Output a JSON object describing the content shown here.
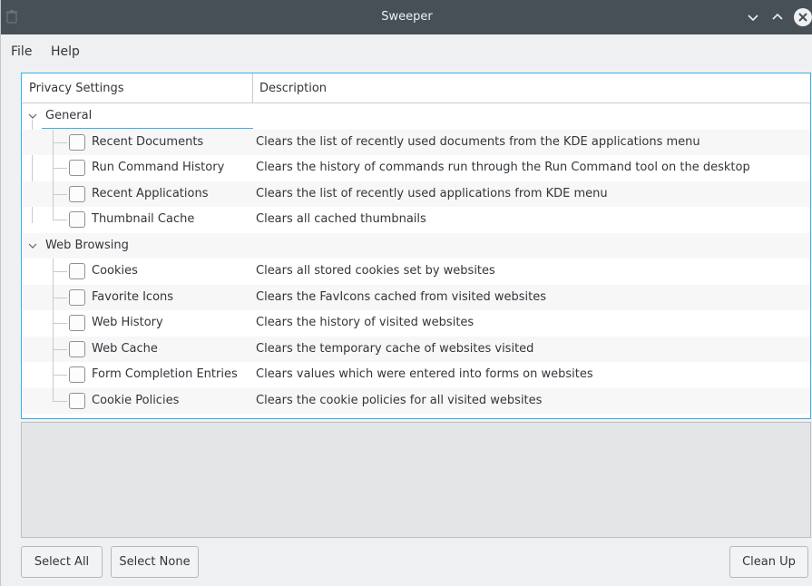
{
  "window": {
    "title": "Sweeper",
    "colors": {
      "titlebar": "#475057",
      "accent": "#3daee9",
      "background": "#eff0f1"
    }
  },
  "menubar": {
    "file": "File",
    "help": "Help"
  },
  "tree": {
    "columns": {
      "privacy": "Privacy Settings",
      "description": "Description"
    },
    "groups": [
      {
        "label": "General",
        "expanded": true,
        "items": [
          {
            "label": "Recent Documents",
            "description": "Clears the list of recently used documents from the KDE applications menu",
            "checked": false
          },
          {
            "label": "Run Command History",
            "description": "Clears the history of commands run through the Run Command tool on the desktop",
            "checked": false
          },
          {
            "label": "Recent Applications",
            "description": "Clears the list of recently used applications from KDE menu",
            "checked": false
          },
          {
            "label": "Thumbnail Cache",
            "description": "Clears all cached thumbnails",
            "checked": false
          }
        ]
      },
      {
        "label": "Web Browsing",
        "expanded": true,
        "items": [
          {
            "label": "Cookies",
            "description": "Clears all stored cookies set by websites",
            "checked": false
          },
          {
            "label": "Favorite Icons",
            "description": "Clears the FavIcons cached from visited websites",
            "checked": false
          },
          {
            "label": "Web History",
            "description": "Clears the history of visited websites",
            "checked": false
          },
          {
            "label": "Web Cache",
            "description": "Clears the temporary cache of websites visited",
            "checked": false
          },
          {
            "label": "Form Completion Entries",
            "description": "Clears values which were entered into forms on websites",
            "checked": false
          },
          {
            "label": "Cookie Policies",
            "description": "Clears the cookie policies for all visited websites",
            "checked": false
          }
        ]
      }
    ]
  },
  "buttons": {
    "select_all": "Select All",
    "select_none": "Select None",
    "clean_up": "Clean Up"
  },
  "icons": {
    "app": "trash-icon",
    "minimize": "chevron-down-icon",
    "maximize": "chevron-up-icon",
    "close": "close-icon",
    "expander": "chevron-down-icon"
  }
}
